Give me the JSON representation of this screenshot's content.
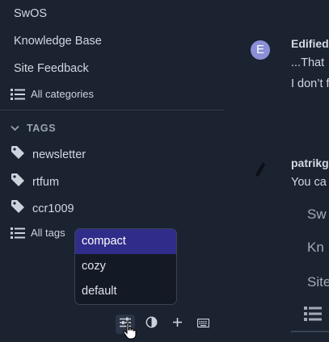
{
  "sidebar": {
    "categories": [
      "SwOS",
      "Knowledge Base",
      "Site Feedback"
    ],
    "all_categories_label": "All categories",
    "tags_title": "TAGS",
    "tags": [
      "newsletter",
      "rtfum",
      "ccr1009"
    ],
    "all_tags_label": "All tags"
  },
  "density_menu": {
    "options": [
      "compact",
      "cozy",
      "default"
    ],
    "selected": "compact"
  },
  "toolbar": {
    "icons": [
      "sliders-icon",
      "contrast-icon",
      "plus-icon",
      "keyboard-icon"
    ]
  },
  "posts": [
    {
      "author": "Edified",
      "lines": [
        "...That",
        "I don’t f"
      ],
      "avatar_letter": "E"
    },
    {
      "author": "patrikg",
      "lines": [
        "You ca"
      ],
      "quoted": [
        "Sw",
        "Kn",
        "Site"
      ]
    }
  ],
  "colors": {
    "accent": "#302d8a",
    "background": "#1b2230"
  }
}
